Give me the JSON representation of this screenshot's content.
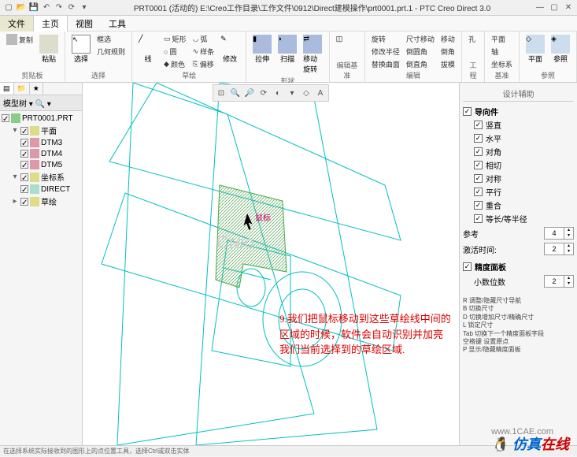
{
  "title": "PRT0001 (活动的) E:\\Creo工作目录\\工作文件\\0912\\Direct建模操作\\prt0001.prt.1 - PTC Creo Direct 3.0",
  "menu": {
    "file": "文件",
    "home": "主页",
    "view": "视图",
    "tools": "工具"
  },
  "ribbon": {
    "clipboard": {
      "label": "剪贴板",
      "copy": "复制",
      "paste": "粘贴"
    },
    "select": {
      "label": "选择",
      "select": "选择",
      "box": "框选",
      "geom": "几何规则"
    },
    "sketch": {
      "label": "草绘",
      "line": "线",
      "rect": "矩形",
      "circle": "圆",
      "color": "颜色",
      "arc": "弧",
      "spline": "样条",
      "offset": "偏移",
      "modify": "修改"
    },
    "shape": {
      "label": "形状",
      "extrude": "拉伸",
      "sweep": "扫描",
      "move": "移动旋转"
    },
    "group_edit_sup": {
      "label": "编辑基准"
    },
    "edit": {
      "label": "编辑",
      "rotate": "旋转",
      "edit_rad": "修改半径",
      "dim": "尺寸移动",
      "move": "移动",
      "replace": "替换曲面",
      "round": "倒圆角",
      "analyze": "倒直角",
      "chamfer": "倒角",
      "hole": "孔",
      "add": "拔模"
    },
    "project": {
      "label": "工程",
      "hole": "孔"
    },
    "datum": {
      "label": "基准",
      "plane": "平面",
      "axis": "轴",
      "csys": "坐标系"
    },
    "ref": {
      "label": "参照",
      "plane": "平面",
      "ref": "参照"
    }
  },
  "tree": {
    "tab_model": "模型",
    "label": "模型树",
    "root": "PRT0001.PRT",
    "planes": "平面",
    "dtm3": "DTM3",
    "dtm4": "DTM4",
    "dtm5": "DTM5",
    "csys": "坐标系",
    "direct": "DIRECT",
    "sketch": "草绘"
  },
  "right": {
    "title": "设计辅助",
    "guide": "导向件",
    "vert": "竖直",
    "horiz": "水平",
    "diag": "对角",
    "tangent": "相切",
    "sym": "对称",
    "parallel": "平行",
    "coincident": "重合",
    "equal": "等长/等半径",
    "ref_count": "参考",
    "ref_val": "4",
    "activate_time": "激活时间:",
    "activate_val": "2",
    "precision_panel": "精度面板",
    "decimals": "小数位数",
    "decimals_val": "2",
    "hints": "R 调整/隐藏尺寸导航\nB 切换尺寸\nD 切换增加尺寸/精确尺寸\nL 锁定尺寸\nTab 切换下一个精度面板字段\n空格键 设置原点\nP 显示/隐藏精度面板"
  },
  "annotation": "9.我们把鼠标移动到这些草绘线中间的区域的时候，软件会自动识别并加亮我们当前选择到的草绘区域.",
  "cursor_label": "鼠标",
  "watermark1": "Creo",
  "footer_url": "www.1CAE.com",
  "footer_logo_1": "仿真",
  "footer_logo_2": "在线",
  "status": "在选择系统实际接收到的图形上的点位置工具，选择Ctrl或双击实体"
}
